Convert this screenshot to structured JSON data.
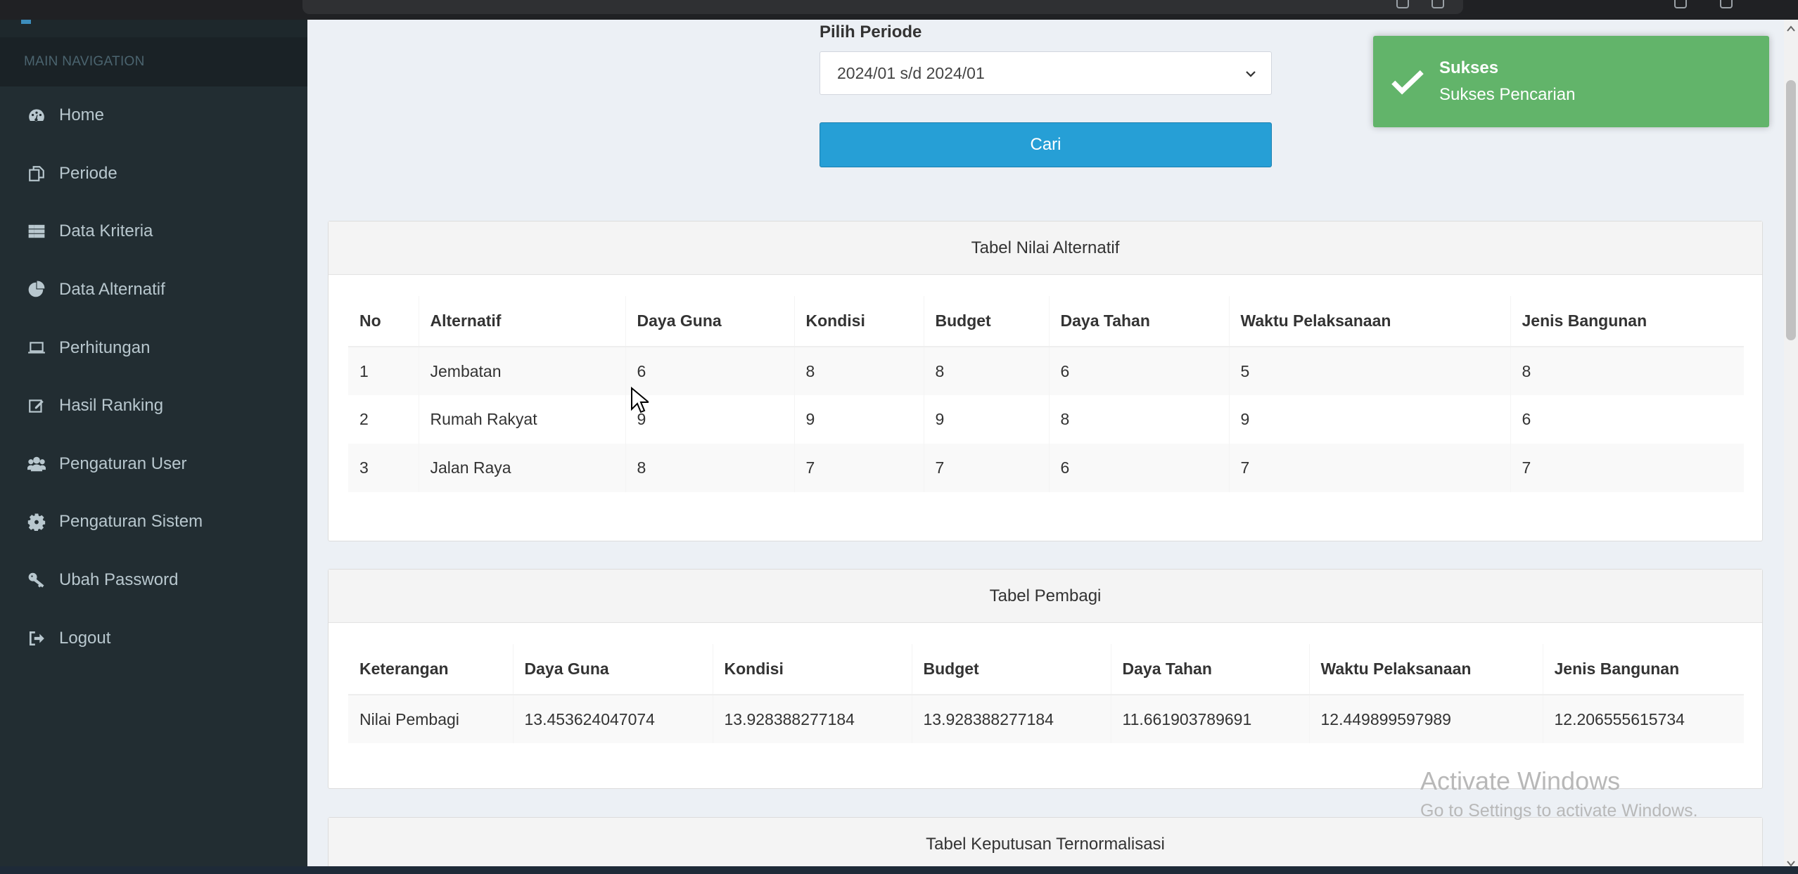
{
  "sidebar": {
    "header": "MAIN NAVIGATION",
    "items": [
      {
        "label": "Home",
        "icon": "dashboard-icon"
      },
      {
        "label": "Periode",
        "icon": "copy-icon"
      },
      {
        "label": "Data Kriteria",
        "icon": "grid-icon"
      },
      {
        "label": "Data Alternatif",
        "icon": "pie-chart-icon"
      },
      {
        "label": "Perhitungan",
        "icon": "laptop-icon"
      },
      {
        "label": "Hasil Ranking",
        "icon": "edit-icon"
      },
      {
        "label": "Pengaturan User",
        "icon": "users-icon"
      },
      {
        "label": "Pengaturan Sistem",
        "icon": "gear-icon"
      },
      {
        "label": "Ubah Password",
        "icon": "key-icon"
      },
      {
        "label": "Logout",
        "icon": "sign-out-icon"
      }
    ]
  },
  "period": {
    "label": "Pilih Periode",
    "selected": "2024/01 s/d 2024/01",
    "search_label": "Cari"
  },
  "toast": {
    "title": "Sukses",
    "message": "Sukses Pencarian",
    "color": "#62b46a"
  },
  "table_alternatif": {
    "title": "Tabel Nilai Alternatif",
    "headers": [
      "No",
      "Alternatif",
      "Daya Guna",
      "Kondisi",
      "Budget",
      "Daya Tahan",
      "Waktu Pelaksanaan",
      "Jenis Bangunan"
    ],
    "rows": [
      [
        "1",
        "Jembatan",
        "6",
        "8",
        "8",
        "6",
        "5",
        "8"
      ],
      [
        "2",
        "Rumah Rakyat",
        "9",
        "9",
        "9",
        "8",
        "9",
        "6"
      ],
      [
        "3",
        "Jalan Raya",
        "8",
        "7",
        "7",
        "6",
        "7",
        "7"
      ]
    ]
  },
  "table_pembagi": {
    "title": "Tabel Pembagi",
    "headers": [
      "Keterangan",
      "Daya Guna",
      "Kondisi",
      "Budget",
      "Daya Tahan",
      "Waktu Pelaksanaan",
      "Jenis Bangunan"
    ],
    "rows": [
      [
        "Nilai Pembagi",
        "13.453624047074",
        "13.928388277184",
        "13.928388277184",
        "11.661903789691",
        "12.449899597989",
        "12.206555615734"
      ]
    ]
  },
  "table_normalisasi": {
    "title": "Tabel Keputusan Ternormalisasi"
  },
  "watermark": {
    "title": "Activate Windows",
    "subtitle": "Go to Settings to activate Windows."
  },
  "colors": {
    "sidebar_bg": "#222d32",
    "button_bg": "#269fd6",
    "content_bg": "#ecf0f5"
  }
}
